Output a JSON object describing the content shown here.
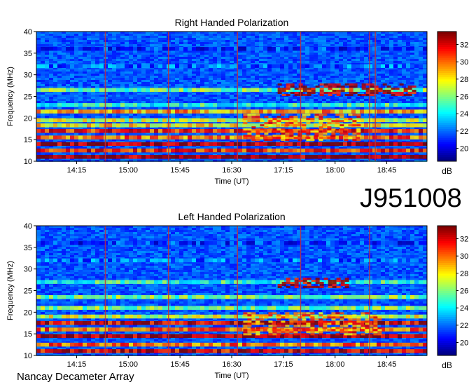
{
  "observation_id": "J951008",
  "credit": "Nancay Decameter Array",
  "colorbar_unit": "dB",
  "chart_data": [
    {
      "type": "heatmap",
      "title": "Right Handed Polarization",
      "xlabel": "Time (UT)",
      "ylabel": "Frequency (MHz)",
      "x_ticks": [
        "14:15",
        "15:00",
        "15:45",
        "16:30",
        "17:15",
        "18:00",
        "18:45"
      ],
      "x_range": [
        "13:40",
        "19:20"
      ],
      "y_ticks": [
        10,
        15,
        20,
        25,
        30,
        35,
        40
      ],
      "ylim": [
        10,
        40
      ],
      "colorbar": {
        "label": "dB",
        "ticks": [
          20,
          22,
          24,
          26,
          28,
          30,
          32
        ],
        "range": [
          18.5,
          33.5
        ]
      },
      "vertical_lines_time": [
        "14:40",
        "15:35",
        "16:35",
        "17:30",
        "18:30",
        "18:35"
      ],
      "bands": [
        {
          "f": 11.0,
          "v": 33
        },
        {
          "f": 12.5,
          "v": 31
        },
        {
          "f": 14.0,
          "v": 33
        },
        {
          "f": 15.5,
          "v": 30
        },
        {
          "f": 17.0,
          "v": 31
        },
        {
          "f": 18.3,
          "v": 28
        },
        {
          "f": 19.5,
          "v": 27
        },
        {
          "f": 21.5,
          "v": 29
        },
        {
          "f": 23.0,
          "v": 25
        },
        {
          "f": 26.5,
          "v": 26
        },
        {
          "f": 32.0,
          "v": 22
        },
        {
          "f": 36.0,
          "v": 21
        }
      ],
      "events": [
        {
          "t_start": "17:10",
          "t_end": "19:10",
          "f_low": 25.5,
          "f_high": 28.0,
          "v": 33
        },
        {
          "t_start": "16:40",
          "t_end": "18:20",
          "f_low": 15.0,
          "f_high": 21.0,
          "v": 30
        }
      ]
    },
    {
      "type": "heatmap",
      "title": "Left Handed Polarization",
      "xlabel": "Time (UT)",
      "ylabel": "Frequency (MHz)",
      "x_ticks": [
        "14:15",
        "15:00",
        "15:45",
        "16:30",
        "17:15",
        "18:00",
        "18:45"
      ],
      "x_range": [
        "13:40",
        "19:20"
      ],
      "y_ticks": [
        10,
        15,
        20,
        25,
        30,
        35,
        40
      ],
      "ylim": [
        10,
        40
      ],
      "colorbar": {
        "label": "dB",
        "ticks": [
          20,
          22,
          24,
          26,
          28,
          30,
          32
        ],
        "range": [
          18.5,
          33.5
        ]
      },
      "vertical_lines_time": [
        "14:40",
        "15:35",
        "16:35",
        "17:30",
        "18:30"
      ],
      "bands": [
        {
          "f": 11.0,
          "v": 32
        },
        {
          "f": 12.5,
          "v": 30
        },
        {
          "f": 14.5,
          "v": 33
        },
        {
          "f": 16.0,
          "v": 30
        },
        {
          "f": 17.5,
          "v": 32
        },
        {
          "f": 19.0,
          "v": 27
        },
        {
          "f": 21.0,
          "v": 26
        },
        {
          "f": 23.5,
          "v": 26
        },
        {
          "f": 27.0,
          "v": 25
        },
        {
          "f": 32.0,
          "v": 22
        },
        {
          "f": 36.0,
          "v": 21
        }
      ],
      "events": [
        {
          "t_start": "17:10",
          "t_end": "18:10",
          "f_low": 26.0,
          "f_high": 28.0,
          "v": 33
        },
        {
          "t_start": "16:40",
          "t_end": "18:40",
          "f_low": 15.0,
          "f_high": 20.0,
          "v": 30
        }
      ]
    }
  ]
}
